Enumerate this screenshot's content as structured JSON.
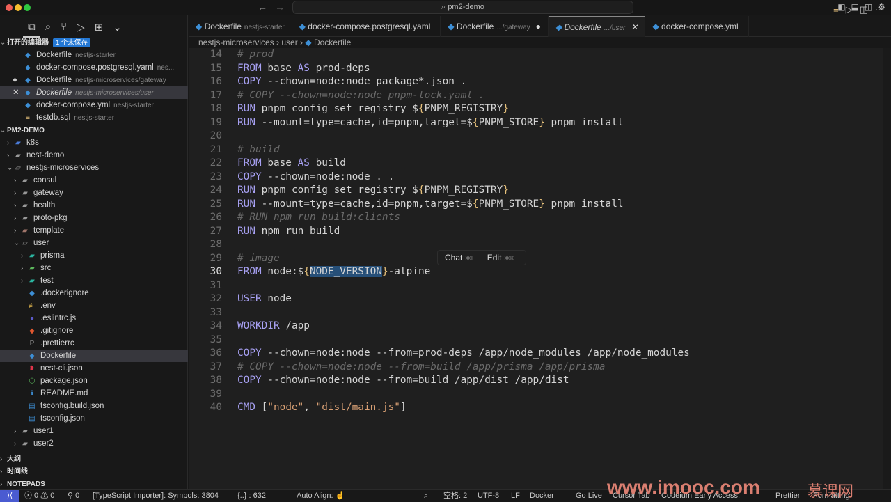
{
  "window": {
    "title": "pm2-demo",
    "back": "←",
    "forward": "→"
  },
  "activity": [
    "⧉",
    "⌕",
    "⑂",
    "▷",
    "⊞",
    "⌄"
  ],
  "open_editors": {
    "title": "打开的编辑器",
    "badge": "1 个未保存",
    "items": [
      {
        "name": "Dockerfile",
        "desc": "nestjs-starter",
        "icon": "docker",
        "mark": ""
      },
      {
        "name": "docker-compose.postgresql.yaml",
        "desc": "nes...",
        "icon": "docker",
        "mark": ""
      },
      {
        "name": "Dockerfile",
        "desc": "nestjs-microservices/gateway",
        "icon": "docker",
        "mark": "●"
      },
      {
        "name": "Dockerfile",
        "desc": "nestjs-microservices/user",
        "icon": "docker",
        "mark": "✕"
      },
      {
        "name": "docker-compose.yml",
        "desc": "nestjs-starter",
        "icon": "docker",
        "mark": ""
      },
      {
        "name": "testdb.sql",
        "desc": "nestjs-starter",
        "icon": "database",
        "mark": ""
      }
    ]
  },
  "explorer": {
    "title": "PM2-DEMO",
    "items": [
      {
        "name": "k8s",
        "depth": 1,
        "chev": "›",
        "icon": "▰",
        "color": "#4a7bd8"
      },
      {
        "name": "nest-demo",
        "depth": 1,
        "chev": "›",
        "icon": "▰",
        "color": "#999"
      },
      {
        "name": "nestjs-microservices",
        "depth": 1,
        "chev": "⌄",
        "icon": "▱",
        "color": "#999"
      },
      {
        "name": "consul",
        "depth": 2,
        "chev": "›",
        "icon": "▰",
        "color": "#999"
      },
      {
        "name": "gateway",
        "depth": 2,
        "chev": "›",
        "icon": "▰",
        "color": "#999"
      },
      {
        "name": "health",
        "depth": 2,
        "chev": "›",
        "icon": "▰",
        "color": "#999"
      },
      {
        "name": "proto-pkg",
        "depth": 2,
        "chev": "›",
        "icon": "▰",
        "color": "#999"
      },
      {
        "name": "template",
        "depth": 2,
        "chev": "›",
        "icon": "▰",
        "color": "#a0756a"
      },
      {
        "name": "user",
        "depth": 2,
        "chev": "⌄",
        "icon": "▱",
        "color": "#999"
      },
      {
        "name": "prisma",
        "depth": 3,
        "chev": "›",
        "icon": "▰",
        "color": "#2bb5a0"
      },
      {
        "name": "src",
        "depth": 3,
        "chev": "›",
        "icon": "▰",
        "color": "#5cb85c"
      },
      {
        "name": "test",
        "depth": 3,
        "chev": "›",
        "icon": "▰",
        "color": "#2bb5a0"
      },
      {
        "name": ".dockerignore",
        "depth": 3,
        "chev": "",
        "icon": "◆",
        "color": "#3d8fd6"
      },
      {
        "name": ".env",
        "depth": 3,
        "chev": "",
        "icon": "≢",
        "color": "#d9b04a"
      },
      {
        "name": ".eslintrc.js",
        "depth": 3,
        "chev": "",
        "icon": "●",
        "color": "#5a5ac8"
      },
      {
        "name": ".gitignore",
        "depth": 3,
        "chev": "",
        "icon": "◆",
        "color": "#e0572f"
      },
      {
        "name": ".prettierrc",
        "depth": 3,
        "chev": "",
        "icon": "P",
        "color": "#888"
      },
      {
        "name": "Dockerfile",
        "depth": 3,
        "chev": "",
        "icon": "◆",
        "color": "#3d8fd6",
        "selected": true
      },
      {
        "name": "nest-cli.json",
        "depth": 3,
        "chev": "",
        "icon": "❥",
        "color": "#e0344a"
      },
      {
        "name": "package.json",
        "depth": 3,
        "chev": "",
        "icon": "⬡",
        "color": "#5cb85c"
      },
      {
        "name": "README.md",
        "depth": 3,
        "chev": "",
        "icon": "ℹ",
        "color": "#3d8fd6"
      },
      {
        "name": "tsconfig.build.json",
        "depth": 3,
        "chev": "",
        "icon": "▤",
        "color": "#3d8fd6"
      },
      {
        "name": "tsconfig.json",
        "depth": 3,
        "chev": "",
        "icon": "▤",
        "color": "#3d8fd6"
      },
      {
        "name": "user1",
        "depth": 2,
        "chev": "›",
        "icon": "▰",
        "color": "#999"
      },
      {
        "name": "user2",
        "depth": 2,
        "chev": "›",
        "icon": "▰",
        "color": "#999"
      }
    ]
  },
  "panels": [
    "大纲",
    "时间线",
    "NOTEPADS"
  ],
  "tabs": [
    {
      "name": "Dockerfile",
      "desc": "nestjs-starter",
      "mark": ""
    },
    {
      "name": "docker-compose.postgresql.yaml",
      "desc": "",
      "mark": ""
    },
    {
      "name": "Dockerfile",
      "desc": ".../gateway",
      "mark": "●"
    },
    {
      "name": "Dockerfile",
      "desc": ".../user",
      "mark": "✕",
      "active": true
    },
    {
      "name": "docker-compose.yml",
      "desc": "",
      "mark": ""
    }
  ],
  "breadcrumb": [
    "nestjs-microservices",
    "user",
    "Dockerfile"
  ],
  "editor": {
    "current_line": 30,
    "lines": [
      {
        "n": 14,
        "t": [
          [
            "c",
            "# prod"
          ]
        ]
      },
      {
        "n": 15,
        "t": [
          [
            "k",
            "FROM"
          ],
          [
            "p",
            " base "
          ],
          [
            "k",
            "AS"
          ],
          [
            "p",
            " prod-deps"
          ]
        ]
      },
      {
        "n": 16,
        "t": [
          [
            "k",
            "COPY"
          ],
          [
            "p",
            " --chown=node:node package*.json ."
          ]
        ]
      },
      {
        "n": 17,
        "t": [
          [
            "c",
            "# COPY --chown=node:node pnpm-lock.yaml ."
          ]
        ]
      },
      {
        "n": 18,
        "t": [
          [
            "k",
            "RUN"
          ],
          [
            "p",
            " pnpm config set registry $"
          ],
          [
            "b",
            "{"
          ],
          [
            "p",
            "PNPM_REGISTRY"
          ],
          [
            "b",
            "}"
          ]
        ]
      },
      {
        "n": 19,
        "t": [
          [
            "k",
            "RUN"
          ],
          [
            "p",
            " --mount=type=cache,id=pnpm,target=$"
          ],
          [
            "b",
            "{"
          ],
          [
            "p",
            "PNPM_STORE"
          ],
          [
            "b",
            "}"
          ],
          [
            "p",
            " pnpm install"
          ]
        ]
      },
      {
        "n": 20,
        "t": []
      },
      {
        "n": 21,
        "t": [
          [
            "c",
            "# build"
          ]
        ]
      },
      {
        "n": 22,
        "t": [
          [
            "k",
            "FROM"
          ],
          [
            "p",
            " base "
          ],
          [
            "k",
            "AS"
          ],
          [
            "p",
            " build"
          ]
        ]
      },
      {
        "n": 23,
        "t": [
          [
            "k",
            "COPY"
          ],
          [
            "p",
            " --chown=node:node . ."
          ]
        ]
      },
      {
        "n": 24,
        "t": [
          [
            "k",
            "RUN"
          ],
          [
            "p",
            " pnpm config set registry $"
          ],
          [
            "b",
            "{"
          ],
          [
            "p",
            "PNPM_REGISTRY"
          ],
          [
            "b",
            "}"
          ]
        ]
      },
      {
        "n": 25,
        "t": [
          [
            "k",
            "RUN"
          ],
          [
            "p",
            " --mount=type=cache,id=pnpm,target=$"
          ],
          [
            "b",
            "{"
          ],
          [
            "p",
            "PNPM_STORE"
          ],
          [
            "b",
            "}"
          ],
          [
            "p",
            " pnpm install"
          ]
        ]
      },
      {
        "n": 26,
        "t": [
          [
            "c",
            "# RUN npm run build:clients"
          ]
        ]
      },
      {
        "n": 27,
        "t": [
          [
            "k",
            "RUN"
          ],
          [
            "p",
            " npm run build"
          ]
        ]
      },
      {
        "n": 28,
        "t": []
      },
      {
        "n": 29,
        "t": [
          [
            "c",
            "# image"
          ]
        ]
      },
      {
        "n": 30,
        "t": [
          [
            "k",
            "FROM"
          ],
          [
            "p",
            " node:$"
          ],
          [
            "b",
            "{"
          ],
          [
            "sel",
            "NODE_VERSION"
          ],
          [
            "b",
            "}"
          ],
          [
            "p",
            "-alpine"
          ]
        ]
      },
      {
        "n": 31,
        "t": []
      },
      {
        "n": 32,
        "t": [
          [
            "k",
            "USER"
          ],
          [
            "p",
            " node"
          ]
        ]
      },
      {
        "n": 33,
        "t": []
      },
      {
        "n": 34,
        "t": [
          [
            "k",
            "WORKDIR"
          ],
          [
            "p",
            " /app"
          ]
        ]
      },
      {
        "n": 35,
        "t": []
      },
      {
        "n": 36,
        "t": [
          [
            "k",
            "COPY"
          ],
          [
            "p",
            " --chown=node:node --from=prod-deps /app/node_modules /app/node_modules"
          ]
        ]
      },
      {
        "n": 37,
        "t": [
          [
            "c",
            "# COPY --chown=node:node --from=build /app/prisma /app/prisma"
          ]
        ]
      },
      {
        "n": 38,
        "t": [
          [
            "k",
            "COPY"
          ],
          [
            "p",
            " --chown=node:node --from=build /app/dist /app/dist"
          ]
        ]
      },
      {
        "n": 39,
        "t": []
      },
      {
        "n": 40,
        "t": [
          [
            "k",
            "CMD"
          ],
          [
            "p",
            " ["
          ],
          [
            "s",
            "\"node\""
          ],
          [
            "p",
            ", "
          ],
          [
            "s",
            "\"dist/main.js\""
          ],
          [
            "p",
            "]"
          ]
        ]
      }
    ]
  },
  "popup": {
    "chat": "Chat",
    "chat_key": "⌘L",
    "edit": "Edit",
    "edit_key": "⌘K"
  },
  "status": {
    "errors": "ⓧ 0 ⚠ 0",
    "ports": "⚲ 0",
    "importer": "[TypeScript Importer]: Symbols: 3804",
    "braces": "{..} : 632",
    "align": "Auto Align: ☝",
    "spaces": "空格: 2",
    "encoding": "UTF-8",
    "eol": "LF",
    "lang": "Docker",
    "golive": "Go Live",
    "cursortab": "Cursor Tab",
    "codeium": "Codeium Early Access:",
    "prettier": "Prettier",
    "formatting": "Formatting"
  },
  "watermark": {
    "site": "www.imooc.com",
    "brand": "慕课网"
  }
}
